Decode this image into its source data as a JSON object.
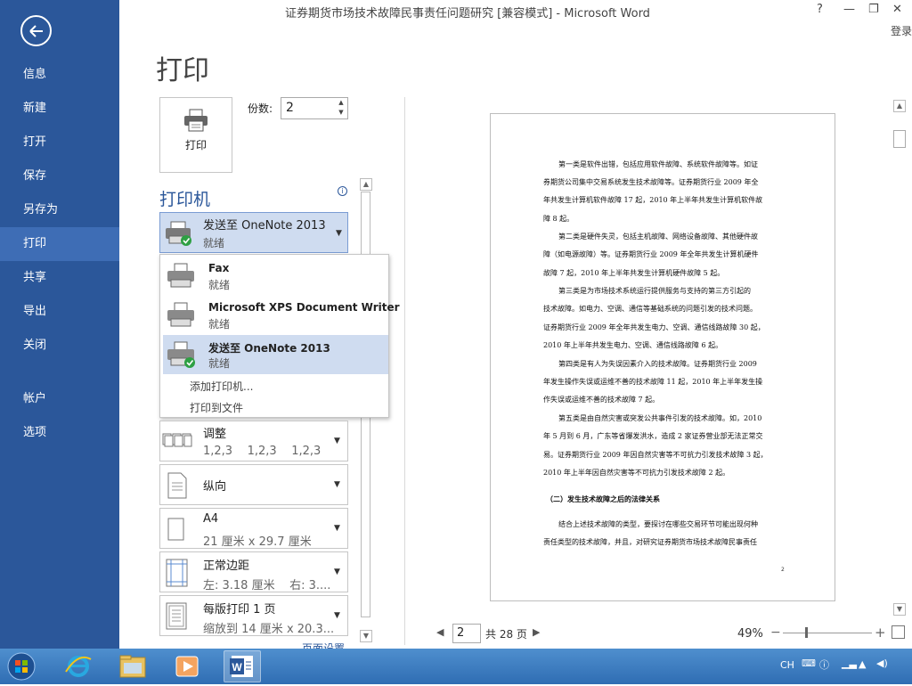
{
  "window": {
    "title": "证券期货市场技术故障民事责任问题研究 [兼容模式] - Microsoft Word",
    "help": "?",
    "minimize": "—",
    "restore": "❐",
    "close": "✕",
    "login": "登录"
  },
  "sidebar": {
    "back_icon": "back-arrow-icon",
    "items": [
      {
        "label": "信息"
      },
      {
        "label": "新建"
      },
      {
        "label": "打开"
      },
      {
        "label": "保存"
      },
      {
        "label": "另存为"
      },
      {
        "label": "打印",
        "active": true
      },
      {
        "label": "共享"
      },
      {
        "label": "导出"
      },
      {
        "label": "关闭"
      },
      {
        "label": "帐户"
      },
      {
        "label": "选项"
      }
    ]
  },
  "print": {
    "heading": "打印",
    "button_label": "打印",
    "copies_label": "份数:",
    "copies_value": "2",
    "printer_section_title": "打印机",
    "selected_printer": {
      "name": "发送至 OneNote 2013",
      "status": "就绪"
    },
    "printers": [
      {
        "name": "Fax",
        "status": "就绪"
      },
      {
        "name": "Microsoft XPS Document Writer",
        "status": "就绪"
      },
      {
        "name": "发送至 OneNote 2013",
        "status": "就绪",
        "selected": true
      }
    ],
    "add_printer": "添加打印机...",
    "print_to_file": "打印到文件",
    "settings": {
      "collate": {
        "title": "调整",
        "detail": "1,2,3    1,2,3    1,2,3"
      },
      "orientation": {
        "title": "纵向"
      },
      "paper": {
        "title": "A4",
        "detail": "21 厘米 x 29.7 厘米"
      },
      "margins": {
        "title": "正常边距",
        "detail": "左: 3.18 厘米    右: 3...."
      },
      "pages_per_sheet": {
        "title": "每版打印 1 页",
        "detail": "缩放到 14 厘米 x 20.3..."
      }
    },
    "page_setup_link": "页面设置"
  },
  "preview": {
    "lines": [
      "第一类是软件出错，包括应用软件故障、系统软件故障等。如证",
      "券期货公司集中交易系统发生技术故障等。证券期货行业 2009 年全",
      "年共发生计算机软件故障 17 起，2010 年上半年共发生计算机软件故",
      "障 8 起。",
      "第二类是硬件失灵，包括主机故障、网络设备故障、其他硬件故",
      "障（如电源故障）等。证券期货行业 2009 年全年共发生计算机硬件",
      "故障 7 起，2010 年上半年共发生计算机硬件故障 5 起。",
      "第三类是为市场技术系统运行提供服务与支持的第三方引起的",
      "技术故障。如电力、空调、通信等基础系统的问题引发的技术问题。",
      "证券期货行业 2009 年全年共发生电力、空调、通信线路故障 30 起，",
      "2010 年上半年共发生电力、空调、通信线路故障 6 起。",
      "第四类是有人为失误因素介入的技术故障。证券期货行业 2009",
      "年发生操作失误或运维不善的技术故障 11 起，2010 年上半年发生操",
      "作失误或运维不善的技术故障 7 起。",
      "第五类是由自然灾害或突发公共事件引发的技术故障。如，2010",
      "年 5 月到 6 月，广东等省爆发洪水，造成 2 家证券营业部无法正常交",
      "易。证券期货行业 2009 年因自然灾害等不可抗力引发技术故障 3 起，",
      "2010 年上半年因自然灾害等不可抗力引发技术故障 2 起。",
      "（二）发生技术故障之后的法律关系",
      "结合上述技术故障的类型，要探讨在哪些交易环节可能出现何种",
      "责任类型的技术故障，并且，对研究证券期货市场技术故障民事责任"
    ],
    "page_number": "2",
    "current_page": "2",
    "total_pages": "共 28 页",
    "zoom": "49%"
  },
  "taskbar": {
    "items": [
      "start-orb-icon",
      "internet-explorer-icon",
      "file-explorer-icon",
      "media-player-icon",
      "word-icon"
    ],
    "lang": "CH"
  },
  "colors": {
    "accent": "#2b579a",
    "sidebar_active": "#3e6db5",
    "selection": "#cfdcf0"
  }
}
